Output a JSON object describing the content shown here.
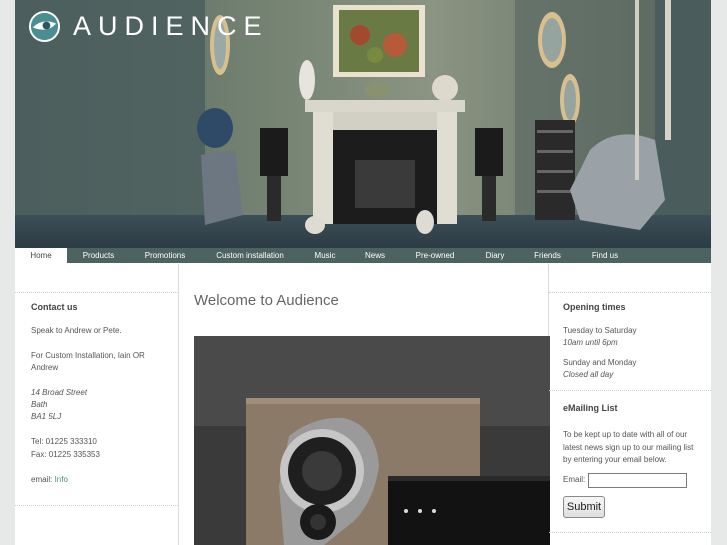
{
  "brand": {
    "name": "AUDIENCE",
    "logo_icon": "eye-logo-icon"
  },
  "nav": {
    "items": [
      {
        "label": "Home",
        "active": true
      },
      {
        "label": "Products"
      },
      {
        "label": "Promotions"
      },
      {
        "label": "Custom installation"
      },
      {
        "label": "Music"
      },
      {
        "label": "News"
      },
      {
        "label": "Pre-owned"
      },
      {
        "label": "Diary"
      },
      {
        "label": "Friends"
      },
      {
        "label": "Find us"
      }
    ]
  },
  "contact": {
    "heading": "Contact us",
    "speak": "Speak to Andrew or Pete.",
    "custom_line1": "For Custom Installation, Iain OR",
    "custom_line2": "Andrew",
    "address": [
      "14 Broad Street",
      "Bath",
      "BA1 5LJ"
    ],
    "tel": "Tel: 01225 333310",
    "fax": "Fax: 01225 335353",
    "email_label": "email: ",
    "email_link": "Info"
  },
  "main": {
    "title": "Welcome to Audience"
  },
  "opening": {
    "heading": "Opening times",
    "weekday_label": "Tuesday to Saturday",
    "weekday_hours": "10am until 6pm",
    "weekend_label": "Sunday and Monday",
    "weekend_hours": "Closed all day"
  },
  "mailing": {
    "heading": "eMailing List",
    "desc_line1": "To be kept up to date with all of our",
    "desc_line2": "latest news sign up to our mailing list",
    "desc_line3": "by entering your email below.",
    "email_label": "Email:",
    "email_value": "",
    "submit_label": "Submit"
  },
  "colors": {
    "nav_bg": "#4d6362",
    "link": "#4f8a86",
    "page_bg": "#e7e9e9"
  }
}
